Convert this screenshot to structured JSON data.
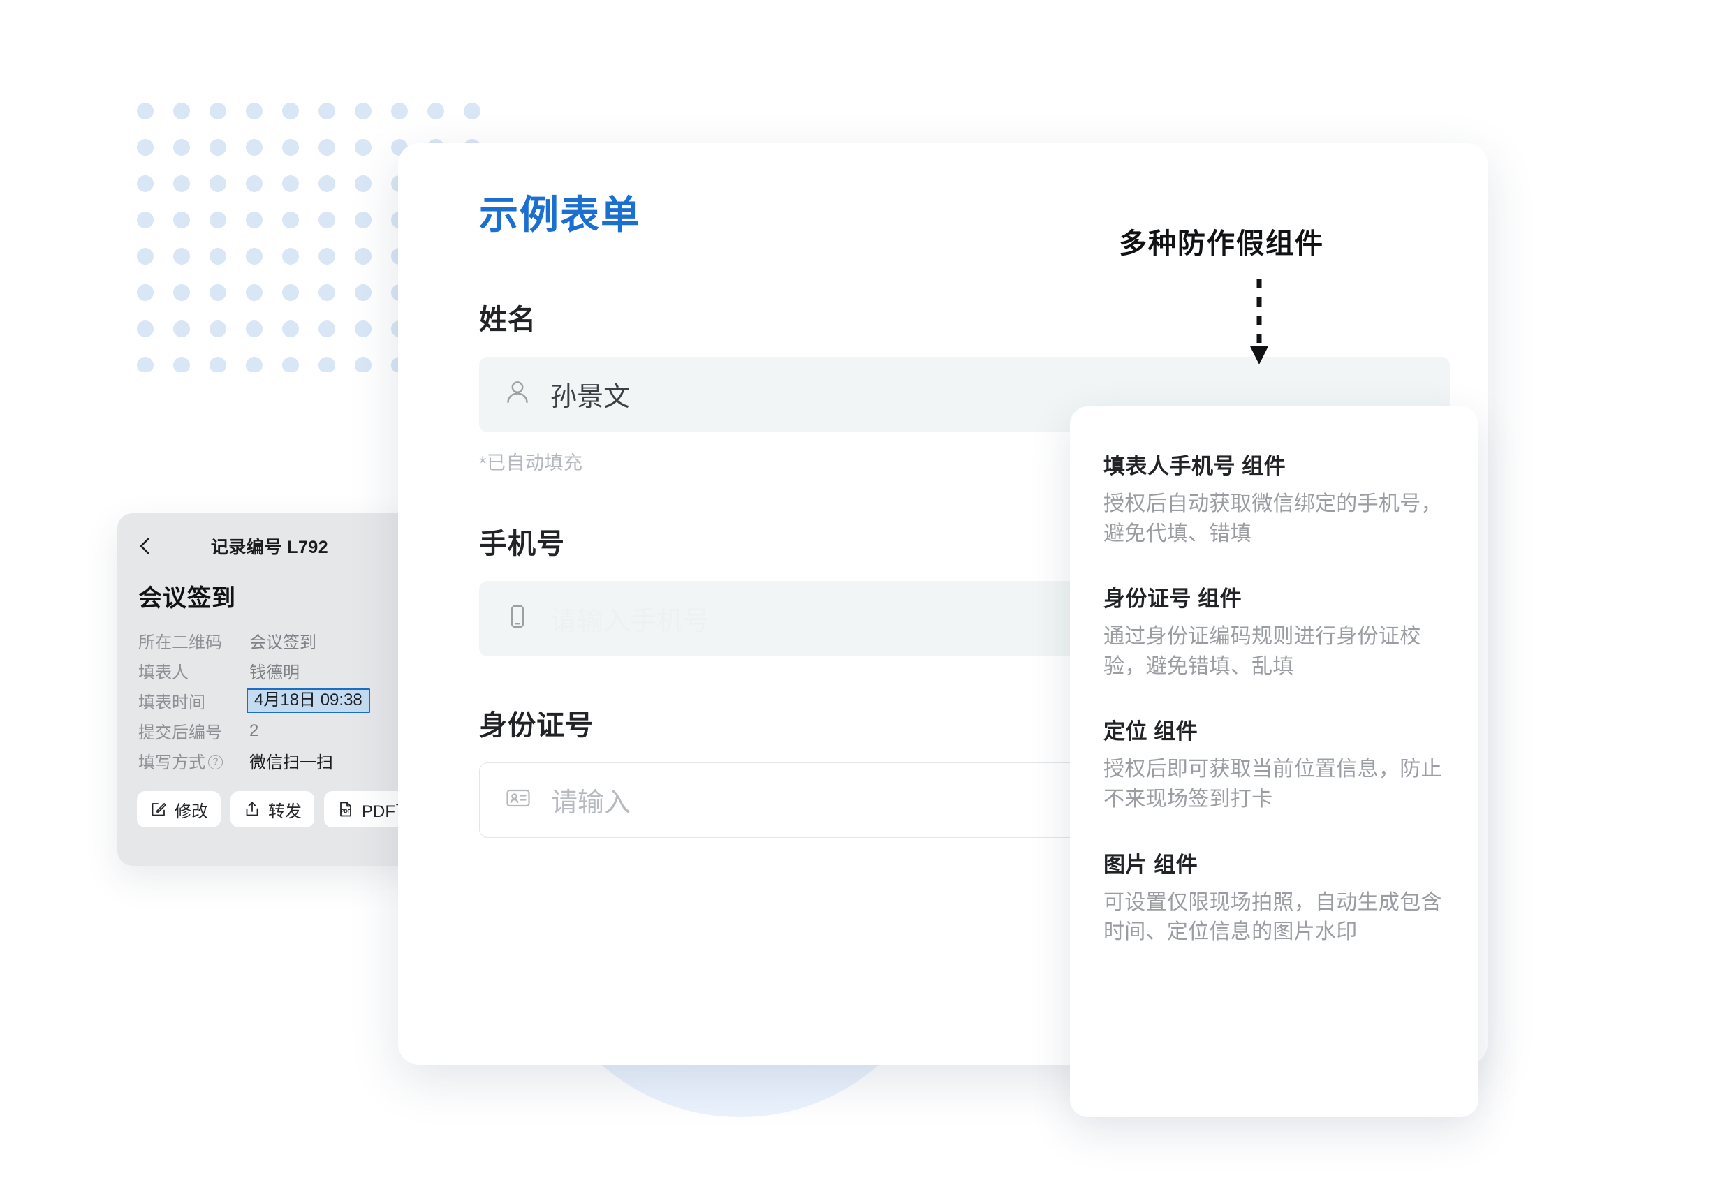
{
  "annotation": {
    "title": "多种防作假组件",
    "arrow_icon": "dashed-down-arrow-icon"
  },
  "record_card": {
    "back_icon": "back-chevron-icon",
    "record_no": "记录编号 L792",
    "title": "会议签到",
    "rows": [
      {
        "label": "所在二维码",
        "value": "会议签到",
        "style": "muted"
      },
      {
        "label": "填表人",
        "value": "钱德明",
        "style": "muted"
      },
      {
        "label": "填表时间",
        "value": "4月18日 09:38",
        "style": "highlight"
      },
      {
        "label": "提交后编号",
        "value": "2",
        "style": "muted"
      },
      {
        "label": "填写方式",
        "value": "微信扫一扫",
        "style": "dark",
        "has_help": true
      }
    ],
    "actions": [
      {
        "icon": "edit-square-icon",
        "label": "修改"
      },
      {
        "icon": "share-upload-icon",
        "label": "转发"
      },
      {
        "icon": "pdf-file-icon",
        "label": "PDF下载"
      }
    ]
  },
  "form_card": {
    "title": "示例表单",
    "title_color": "#1b6fd0",
    "fields": [
      {
        "label": "姓名",
        "icon": "person-icon",
        "value": "孙景文",
        "placeholder": "",
        "variant": "filled",
        "hint": "*已自动填充"
      },
      {
        "label": "手机号",
        "icon": "phone-icon",
        "value": "",
        "placeholder": "请输入手机号",
        "variant": "filled",
        "hint": ""
      },
      {
        "label": "身份证号",
        "icon": "id-card-icon",
        "value": "",
        "placeholder": "请输入",
        "variant": "outlined",
        "hint": ""
      }
    ]
  },
  "components_card": {
    "blocks": [
      {
        "title": "填表人手机号 组件",
        "desc": "授权后自动获取微信绑定的手机号，避免代填、错填"
      },
      {
        "title": "身份证号 组件",
        "desc": "通过身份证编码规则进行身份证校验，避免错填、乱填"
      },
      {
        "title": "定位 组件",
        "desc": "授权后即可获取当前位置信息，防止不来现场签到打卡"
      },
      {
        "title": "图片 组件",
        "desc": "可设置仅限现场拍照，自动生成包含时间、定位信息的图片水印"
      }
    ]
  }
}
